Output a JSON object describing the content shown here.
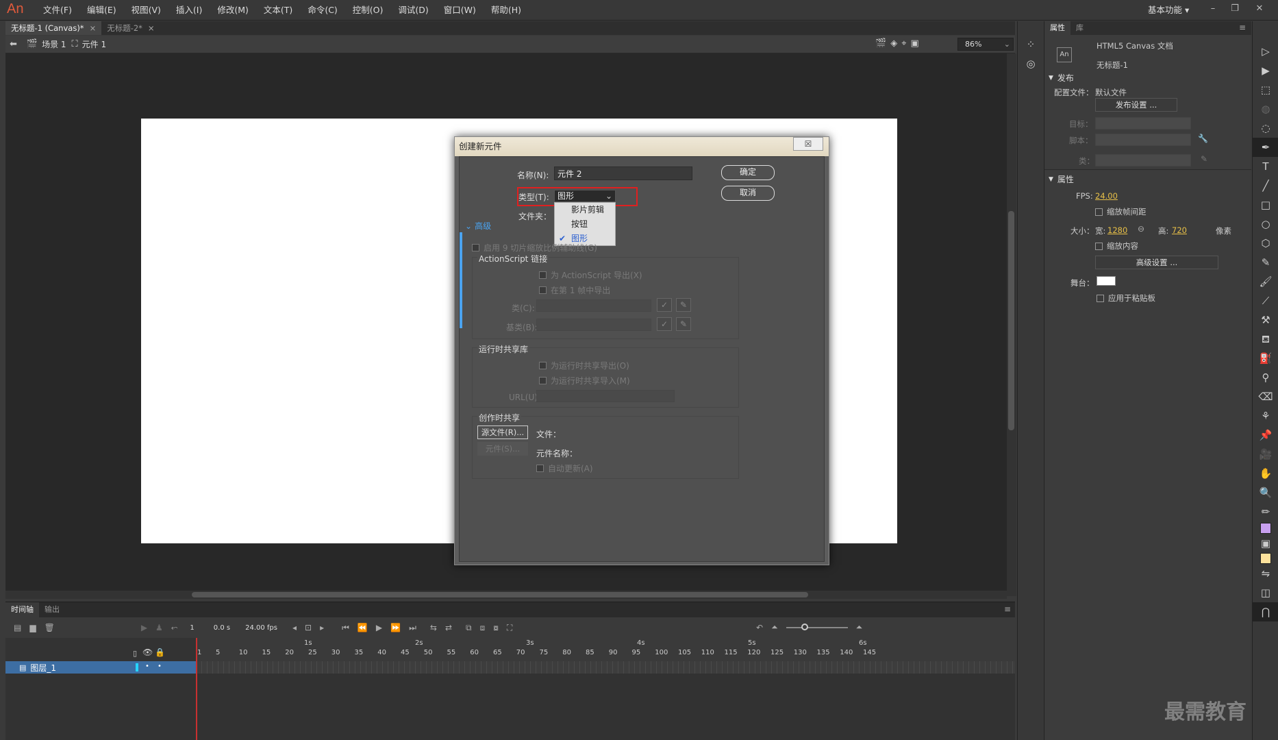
{
  "app": {
    "logo": "An"
  },
  "menus": [
    "文件(F)",
    "编辑(E)",
    "视图(V)",
    "插入(I)",
    "修改(M)",
    "文本(T)",
    "命令(C)",
    "控制(O)",
    "调试(D)",
    "窗口(W)",
    "帮助(H)"
  ],
  "workspace": {
    "label": "基本功能 ▾"
  },
  "window_buttons": {
    "minimize": "–",
    "restore": "❐",
    "close": "✕"
  },
  "doc_tabs": [
    {
      "label": "无标题-1 (Canvas)*",
      "close": "×"
    },
    {
      "label": "无标题-2*",
      "close": "×"
    }
  ],
  "editbar": {
    "scene": "场景 1",
    "symbol": "元件 1",
    "zoom": "86%"
  },
  "timeline": {
    "tabs": [
      "时间轴",
      "输出"
    ],
    "frame": "1",
    "time": "0.0 s",
    "fps": "24.00 fps",
    "seconds": [
      "1s",
      "2s",
      "3s",
      "4s",
      "5s",
      "6s"
    ],
    "ticks": [
      "1",
      "5",
      "10",
      "15",
      "20",
      "25",
      "30",
      "35",
      "40",
      "45",
      "50",
      "55",
      "60",
      "65",
      "70",
      "75",
      "80",
      "85",
      "90",
      "95",
      "100",
      "105",
      "110",
      "115",
      "120",
      "125",
      "130",
      "135",
      "140",
      "145"
    ],
    "layer": "图层_1"
  },
  "panel": {
    "tabs": [
      "属性",
      "库"
    ],
    "doc_type": "HTML5 Canvas 文档",
    "doc_name": "无标题-1",
    "publish": {
      "header": "发布",
      "profile_label": "配置文件：",
      "profile_value": "默认文件",
      "settings_button": "发布设置 ...",
      "target_label": "目标：",
      "script_label": "脚本：",
      "class_label": "类："
    },
    "properties": {
      "header": "属性",
      "fps_label": "FPS:",
      "fps_value": "24.00",
      "scale_spans": "缩放帧间距",
      "size_label": "大小：",
      "width_label": "宽:",
      "width_value": "1280",
      "height_label": "高:",
      "height_value": "720",
      "unit": "像素",
      "scale_content": "缩放内容",
      "advanced_button": "高级设置 ...",
      "stage_label": "舞台：",
      "apply_pasteboard": "应用于粘贴板"
    }
  },
  "dialog": {
    "title": "创建新元件",
    "close": "☒",
    "name_label": "名称(N):",
    "name_value": "元件 2",
    "type_label": "类型(T):",
    "type_value": "图形",
    "folder_label": "文件夹：",
    "ok": "确定",
    "cancel": "取消",
    "type_options": [
      "影片剪辑",
      "按钮",
      "图形"
    ],
    "advanced": "高级",
    "enable_9slice": "启用 9 切片缩放比例辅助线(G)",
    "actionscript": {
      "header": "ActionScript 链接",
      "export_as": "为 ActionScript 导出(X)",
      "export_frame1": "在第 1 帧中导出",
      "class_label": "类(C):",
      "base_class_label": "基类(B):"
    },
    "runtime": {
      "header": "运行时共享库",
      "export_runtime": "为运行时共享导出(O)",
      "import_runtime": "为运行时共享导入(M)",
      "url_label": "URL(U):"
    },
    "authortime": {
      "header": "创作时共享",
      "source_button": "源文件(R)...",
      "file_label": "文件：",
      "symbol_button": "元件(S)...",
      "symbol_name_label": "元件名称：",
      "auto_update": "自动更新(A)"
    }
  },
  "watermark": "最需教育"
}
